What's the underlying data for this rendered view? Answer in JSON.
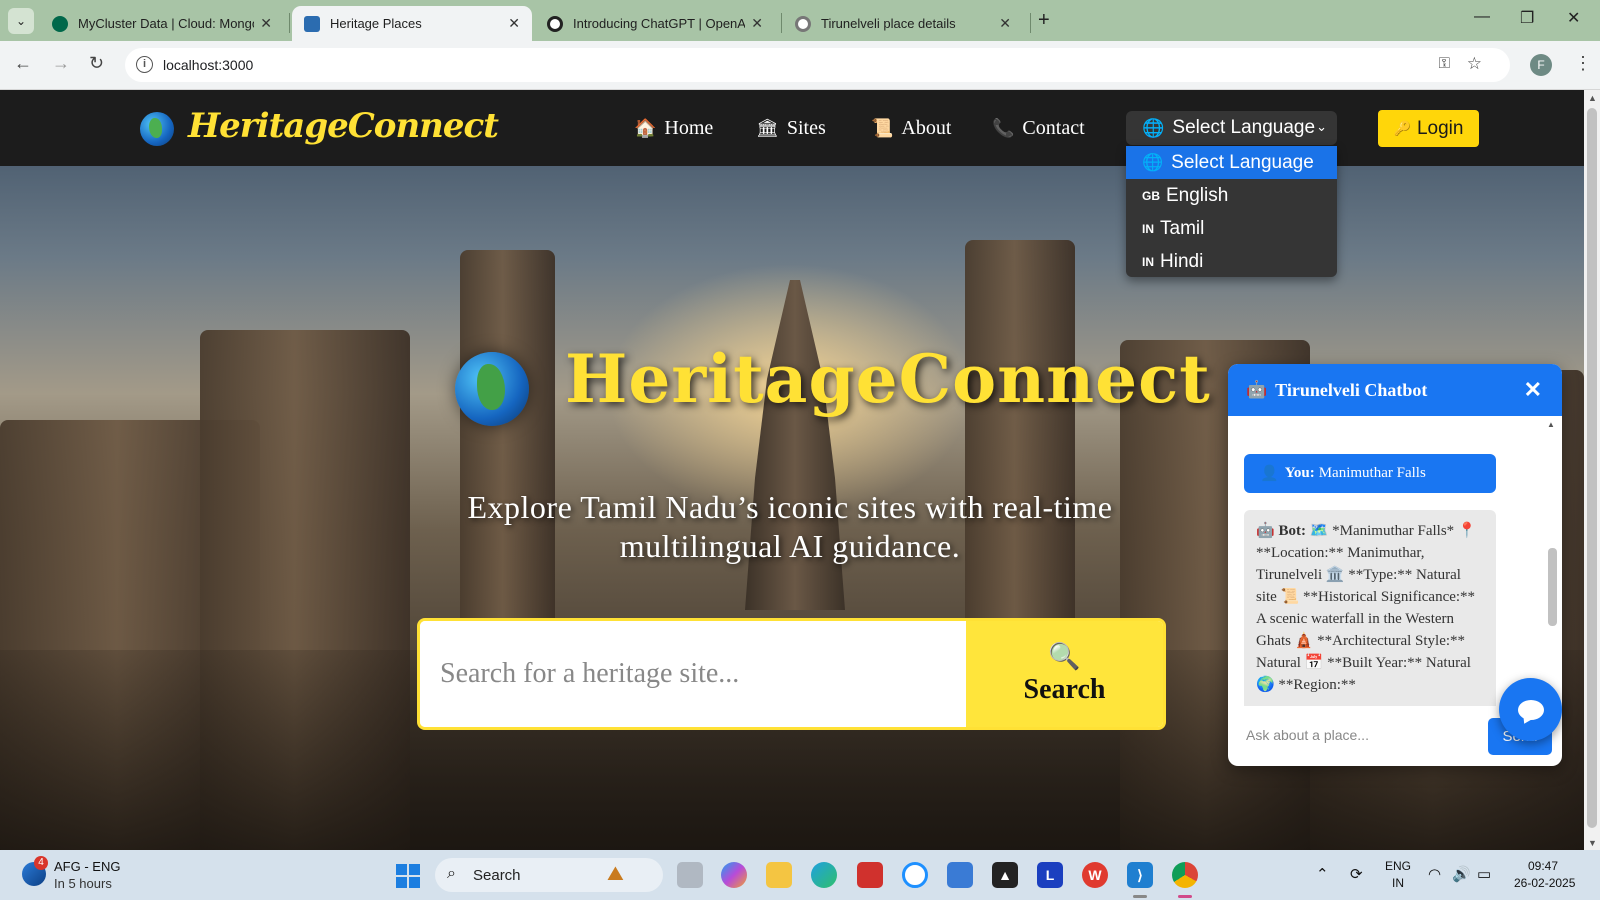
{
  "browser": {
    "tabs": [
      {
        "title": "MyCluster Data | Cloud: MongoDB",
        "active": false,
        "favicon_color": "#00684a"
      },
      {
        "title": "Heritage Places",
        "active": true,
        "favicon_color": "#2b6cb0"
      },
      {
        "title": "Introducing ChatGPT | OpenAI",
        "active": false,
        "favicon_color": "#222222"
      },
      {
        "title": "Tirunelveli place details",
        "active": false,
        "favicon_color": "#666666"
      }
    ],
    "url": "localhost:3000"
  },
  "site": {
    "brand": "HeritageConnect",
    "nav": [
      {
        "icon": "home-icon",
        "glyph": "🏠",
        "label": "Home"
      },
      {
        "icon": "bank-icon",
        "glyph": "🏛",
        "label": "Sites"
      },
      {
        "icon": "scroll-icon",
        "glyph": "📜",
        "label": "About"
      },
      {
        "icon": "phone-icon",
        "glyph": "📞",
        "label": "Contact"
      }
    ],
    "language": {
      "selected": "Select Language",
      "options": [
        {
          "flag": "",
          "label": "Select Language",
          "selected": true
        },
        {
          "flag": "GB",
          "label": "English",
          "selected": false
        },
        {
          "flag": "IN",
          "label": "Tamil",
          "selected": false
        },
        {
          "flag": "IN",
          "label": "Hindi",
          "selected": false
        }
      ]
    },
    "login_label": "Login",
    "colors": {
      "accent": "#ffe135",
      "primary_blue": "#1976f2"
    }
  },
  "hero": {
    "title": "HeritageConnect",
    "subtitle": "Explore Tamil Nadu’s iconic sites with real-time multilingual AI guidance.",
    "search_placeholder": "Search for a heritage site...",
    "search_button": "Search"
  },
  "chatbot": {
    "title": "Tirunelveli Chatbot",
    "user_label": "You:",
    "user_message": "Manimuthar Falls",
    "bot_label": "Bot:",
    "bot_message": "🗺️ *Manimuthar Falls* 📍 **Location:** Manimuthar, Tirunelveli 🏛️ **Type:** Natural site 📜 **Historical Significance:** A scenic waterfall in the Western Ghats 🛕 **Architectural Style:** Natural 📅 **Built Year:** Natural 🌍 **Region:**",
    "input_placeholder": "Ask about a place...",
    "send_label": "Send"
  },
  "taskbar": {
    "weather_line1": "AFG - ENG",
    "weather_line2": "In 5 hours",
    "weather_badge": "4",
    "search_label": "Search",
    "lang_line1": "ENG",
    "lang_line2": "IN",
    "time": "09:47",
    "date": "26-02-2025"
  }
}
